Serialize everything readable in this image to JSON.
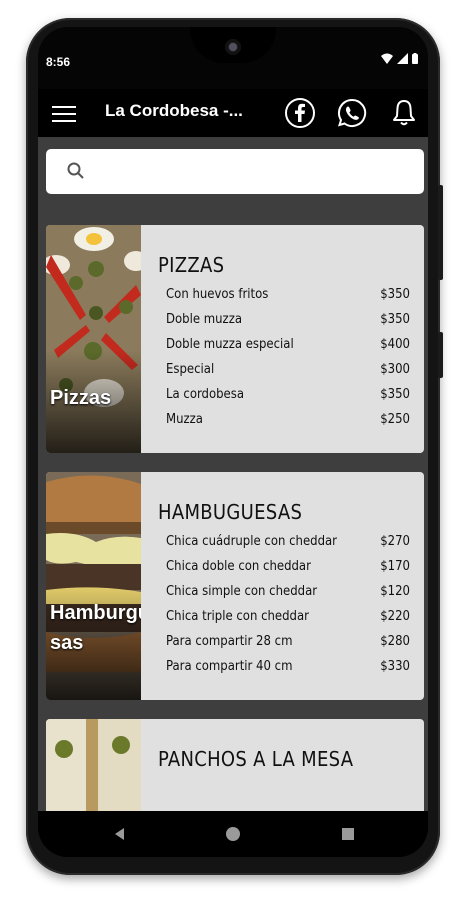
{
  "status": {
    "time": "8:56"
  },
  "appbar": {
    "title": "La Cordobesa -..."
  },
  "search": {
    "placeholder": ""
  },
  "categories": [
    {
      "thumb_label": "Pizzas",
      "title": "PIZZAS",
      "items": [
        {
          "name": "Con huevos fritos",
          "price": "$350"
        },
        {
          "name": "Doble muzza",
          "price": "$350"
        },
        {
          "name": "Doble muzza especial",
          "price": "$400"
        },
        {
          "name": "Especial",
          "price": "$300"
        },
        {
          "name": "La cordobesa",
          "price": "$350"
        },
        {
          "name": "Muzza",
          "price": "$250"
        }
      ]
    },
    {
      "thumb_label": "Hamburgue sas",
      "title": "HAMBUGUESAS",
      "items": [
        {
          "name": "Chica cuádruple con cheddar",
          "price": "$270"
        },
        {
          "name": "Chica doble con cheddar",
          "price": "$170"
        },
        {
          "name": "Chica simple con cheddar",
          "price": "$120"
        },
        {
          "name": "Chica triple con cheddar",
          "price": "$220"
        },
        {
          "name": "Para compartir 28 cm",
          "price": "$280"
        },
        {
          "name": "Para compartir 40 cm",
          "price": "$330"
        }
      ]
    },
    {
      "thumb_label": "",
      "title": "PANCHOS A LA MESA",
      "items": []
    }
  ],
  "icons": {
    "menu": "hamburger-menu-icon",
    "facebook": "facebook-icon",
    "whatsapp": "whatsapp-icon",
    "bell": "bell-icon",
    "search": "search-icon",
    "back": "back-triangle-icon",
    "home": "home-circle-icon",
    "recents": "recents-square-icon"
  },
  "colors": {
    "appbar": "#000000",
    "content_bg": "#3e3e3e",
    "card_bg": "#e0e0e0"
  }
}
